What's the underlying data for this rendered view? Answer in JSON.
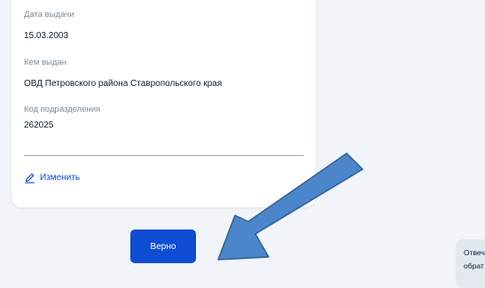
{
  "passport": {
    "issue_date_label": "Дата выдачи",
    "issue_date_value": "15.03.2003",
    "issued_by_label": "Кем выдан",
    "issued_by_value": "ОВД Петровского района Ставропольского края",
    "division_code_label": "Код подразделения",
    "division_code_value": "262025"
  },
  "actions": {
    "edit_label": "Изменить",
    "confirm_label": "Верно"
  },
  "chat": {
    "line1": "Отвеч",
    "line2": "обрат"
  },
  "colors": {
    "primary": "#0d4cd3",
    "arrow_fill": "#4a86c9",
    "arrow_stroke": "#2f5f96",
    "background": "#f1f4f8"
  }
}
